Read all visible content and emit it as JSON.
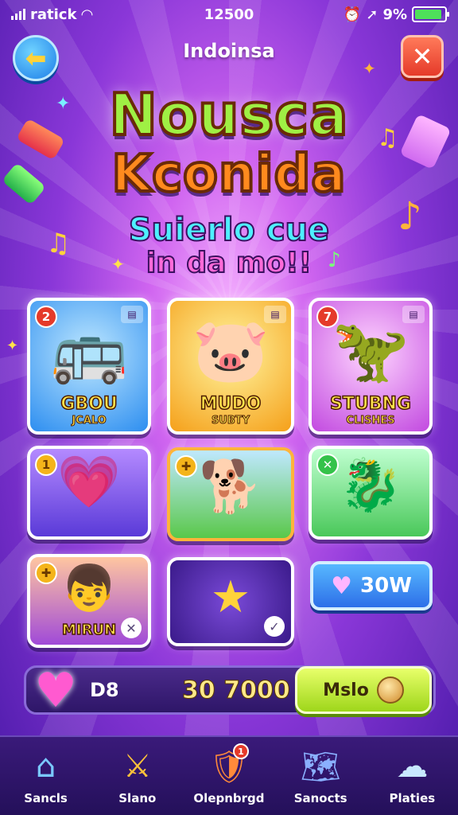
{
  "status_bar": {
    "carrier": "ratick",
    "time": "12500",
    "battery": "9%"
  },
  "header": {
    "title": "Indoinsa"
  },
  "logo": {
    "line1": "Nousca",
    "line2": "Kconida"
  },
  "tagline": {
    "line1": "Suierlo cue",
    "line2": "in da mo!!"
  },
  "tiles": [
    {
      "badge": "2",
      "title": "GBOU",
      "subtitle": "JCALO"
    },
    {
      "badge": "",
      "title": "MUDO",
      "subtitle": "SUBTY"
    },
    {
      "badge": "7",
      "title": "STUBNG",
      "subtitle": "CLISHES"
    },
    {
      "badge": "1",
      "title": "",
      "subtitle": ""
    },
    {
      "badge": "",
      "title": "",
      "subtitle": ""
    },
    {
      "badge": "",
      "title": "",
      "subtitle": ""
    },
    {
      "badge": "",
      "title": "MIRUN",
      "subtitle": ""
    },
    {
      "badge": "",
      "title": "",
      "subtitle": ""
    }
  ],
  "score_pill": {
    "value": "30W"
  },
  "wallet": {
    "label": "D8",
    "amount": "30 7000",
    "button": "Mslo"
  },
  "nav": [
    {
      "label": "Sancls",
      "icon": "home-icon"
    },
    {
      "label": "Slano",
      "icon": "sword-shield-icon"
    },
    {
      "label": "Olepnbrgd",
      "icon": "shield-badge-icon",
      "badge": "1"
    },
    {
      "label": "Sanocts",
      "icon": "map-icon"
    },
    {
      "label": "Platies",
      "icon": "cloud-icon"
    }
  ]
}
